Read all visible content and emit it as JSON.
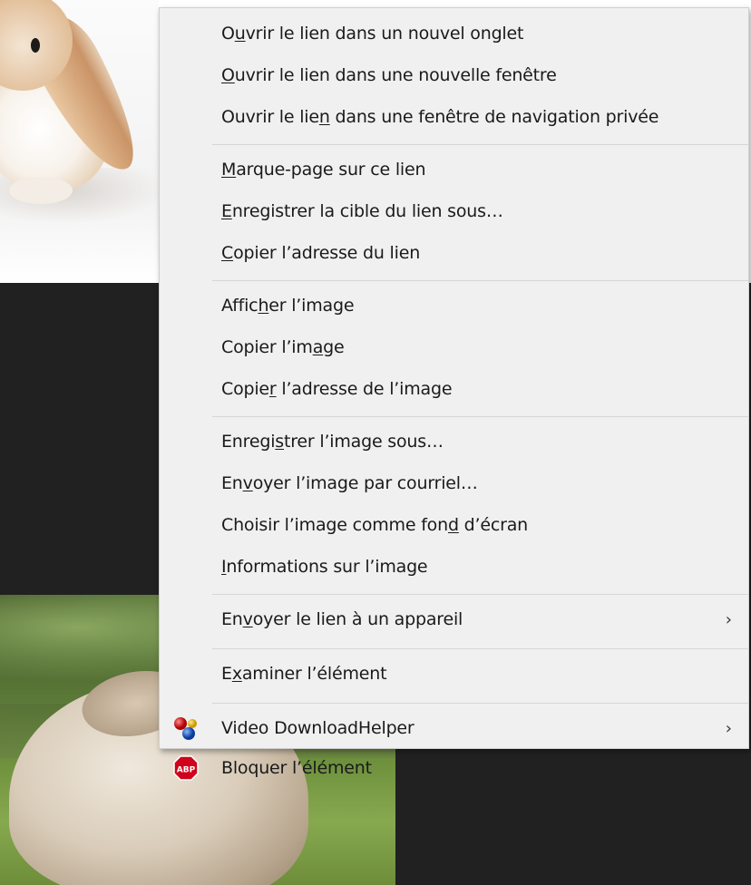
{
  "menu": {
    "groups": [
      [
        {
          "pre": "O",
          "key": "u",
          "post": "vrir le lien dans un nouvel onglet"
        },
        {
          "pre": "",
          "key": "O",
          "post": "uvrir le lien dans une nouvelle fenêtre"
        },
        {
          "pre": "Ouvrir le lie",
          "key": "n",
          "post": " dans une fenêtre de navigation privée"
        }
      ],
      [
        {
          "pre": "",
          "key": "M",
          "post": "arque-page sur ce lien"
        },
        {
          "pre": "",
          "key": "E",
          "post": "nregistrer la cible du lien sous…"
        },
        {
          "pre": "",
          "key": "C",
          "post": "opier l’adresse du lien"
        }
      ],
      [
        {
          "pre": "Affic",
          "key": "h",
          "post": "er l’image"
        },
        {
          "pre": "Copier l’im",
          "key": "a",
          "post": "ge"
        },
        {
          "pre": "Copie",
          "key": "r",
          "post": " l’adresse de l’image"
        }
      ],
      [
        {
          "pre": "Enregi",
          "key": "s",
          "post": "trer l’image sous…"
        },
        {
          "pre": "En",
          "key": "v",
          "post": "oyer l’image par courriel…"
        },
        {
          "pre": "Choisir l’image comme fon",
          "key": "d",
          "post": " d’écran"
        },
        {
          "pre": "",
          "key": "I",
          "post": "nformations sur l’image"
        }
      ],
      [
        {
          "pre": "En",
          "key": "v",
          "post": "oyer le lien à un appareil",
          "submenu": true
        }
      ],
      [
        {
          "pre": "E",
          "key": "x",
          "post": "aminer l’élément"
        }
      ],
      [
        {
          "pre": "Video DownloadHelper",
          "key": "",
          "post": "",
          "submenu": true,
          "icon": "video-downloadhelper-icon"
        },
        {
          "pre": "Bloquer l’élément",
          "key": "",
          "post": "",
          "icon": "adblock-plus-icon",
          "icon_text": "ABP"
        }
      ]
    ],
    "submenu_arrow": "›"
  },
  "colors": {
    "menu_bg": "#f0f0f0",
    "separator": "#d6d6d6",
    "page_dark": "#212121",
    "abp_red": "#d0021b"
  }
}
